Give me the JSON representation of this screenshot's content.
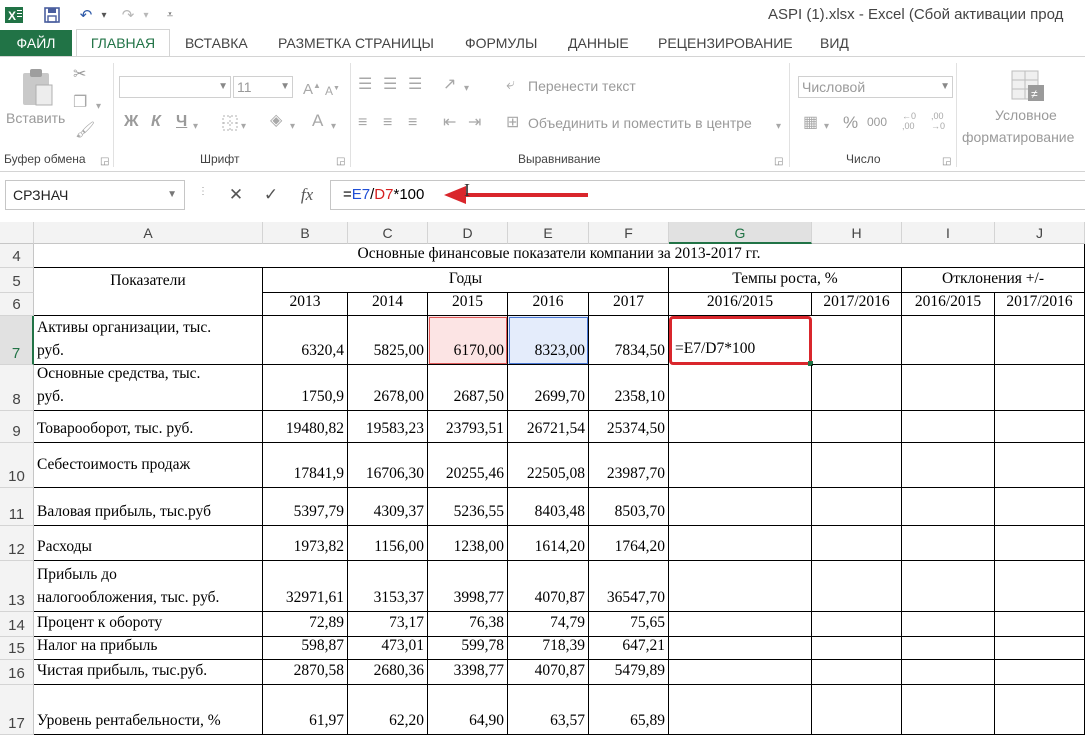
{
  "window": {
    "title": "ASPI (1).xlsx - Excel (Сбой активации прод"
  },
  "quick_access": {
    "excel_icon": "excel-logo",
    "save_icon": "save-icon",
    "undo_icon": "undo-icon",
    "redo_icon": "redo-icon"
  },
  "tabs": [
    "ФАЙЛ",
    "ГЛАВНАЯ",
    "ВСТАВКА",
    "РАЗМЕТКА СТРАНИЦЫ",
    "ФОРМУЛЫ",
    "ДАННЫЕ",
    "РЕЦЕНЗИРОВАНИЕ",
    "ВИД"
  ],
  "ribbon": {
    "clipboard": {
      "paste_label": "Вставить",
      "group_label": "Буфер обмена"
    },
    "font": {
      "font_name": "",
      "font_size": "11",
      "bold": "Ж",
      "italic": "К",
      "underline": "Ч",
      "group_label": "Шрифт"
    },
    "alignment": {
      "wrap_label": "Перенести текст",
      "merge_label": "Объединить и поместить в центре",
      "group_label": "Выравнивание"
    },
    "number": {
      "format": "Числовой",
      "percent": "%",
      "thousands": "000",
      "group_label": "Число"
    },
    "styles": {
      "conditional_label_1": "Условное",
      "conditional_label_2": "форматирование"
    }
  },
  "formula_bar": {
    "name_box": "СРЗНАЧ",
    "fx": "fx",
    "formula_parts": [
      {
        "text": "=",
        "color": "#000000"
      },
      {
        "text": "E7",
        "color": "#1f4fd6"
      },
      {
        "text": "/",
        "color": "#000000"
      },
      {
        "text": "D7",
        "color": "#d61f1f"
      },
      {
        "text": "*100",
        "color": "#000000"
      }
    ]
  },
  "colors": {
    "accent": "#217346",
    "annotation_red": "#d9262c",
    "d7_fill": "#fce4e4",
    "e7_fill": "#e4ecfb"
  },
  "grid": {
    "columns": [
      "A",
      "B",
      "C",
      "D",
      "E",
      "F",
      "G",
      "H",
      "I",
      "J"
    ],
    "selected_column": "G",
    "selected_row": "7",
    "row_numbers": [
      "4",
      "5",
      "6",
      "7",
      "8",
      "9",
      "10",
      "11",
      "12",
      "13",
      "14",
      "15",
      "16",
      "17"
    ],
    "header": {
      "title": "Основные финансовые показатели компании за 2013-2017 гг.",
      "indicators": "Показатели",
      "years": "Годы",
      "growth": "Темпы роста, %",
      "deviation": "Отклонения +/-",
      "year_list": [
        "2013",
        "2014",
        "2015",
        "2016",
        "2017"
      ],
      "growth_sub": [
        "2016/2015",
        "2017/2016"
      ],
      "deviation_sub": [
        "2016/2015",
        "2017/2016"
      ]
    },
    "rows": [
      {
        "label": "Активы организации, тыс.\nруб.",
        "values": [
          "6320,4",
          "5825,00",
          "6170,00",
          "8323,00",
          "7834,50"
        ],
        "g": "=E7/D7*100"
      },
      {
        "label": "Основные средства, тыс.\nруб.",
        "values": [
          "1750,9",
          "2678,00",
          "2687,50",
          "2699,70",
          "2358,10"
        ]
      },
      {
        "label": "Товарооборот, тыс. руб.",
        "values": [
          "19480,82",
          "19583,23",
          "23793,51",
          "26721,54",
          "25374,50"
        ]
      },
      {
        "label": "Себестоимость продаж",
        "values": [
          "17841,9",
          "16706,30",
          "20255,46",
          "22505,08",
          "23987,70"
        ],
        "label_top": true
      },
      {
        "label": "Валовая прибыль, тыс.руб",
        "values": [
          "5397,79",
          "4309,37",
          "5236,55",
          "8403,48",
          "8503,70"
        ]
      },
      {
        "label": "Расходы",
        "values": [
          "1973,82",
          "1156,00",
          "1238,00",
          "1614,20",
          "1764,20"
        ]
      },
      {
        "label": "Прибыль до\nналогообложения, тыс. руб.",
        "values": [
          "32971,61",
          "3153,37",
          "3998,77",
          "4070,87",
          "36547,70"
        ]
      },
      {
        "label": "Процент к обороту",
        "values": [
          "72,89",
          "73,17",
          "76,38",
          "74,79",
          "75,65"
        ]
      },
      {
        "label": "Налог на прибыль",
        "values": [
          "598,87",
          "473,01",
          "599,78",
          "718,39",
          "647,21"
        ]
      },
      {
        "label": "Чистая прибыль, тыс.руб.",
        "values": [
          "2870,58",
          "2680,36",
          "3398,77",
          "4070,87",
          "5479,89"
        ]
      },
      {
        "label": "Уровень рентабельности, %",
        "values": [
          "61,97",
          "62,20",
          "64,90",
          "63,57",
          "65,89"
        ]
      }
    ]
  }
}
